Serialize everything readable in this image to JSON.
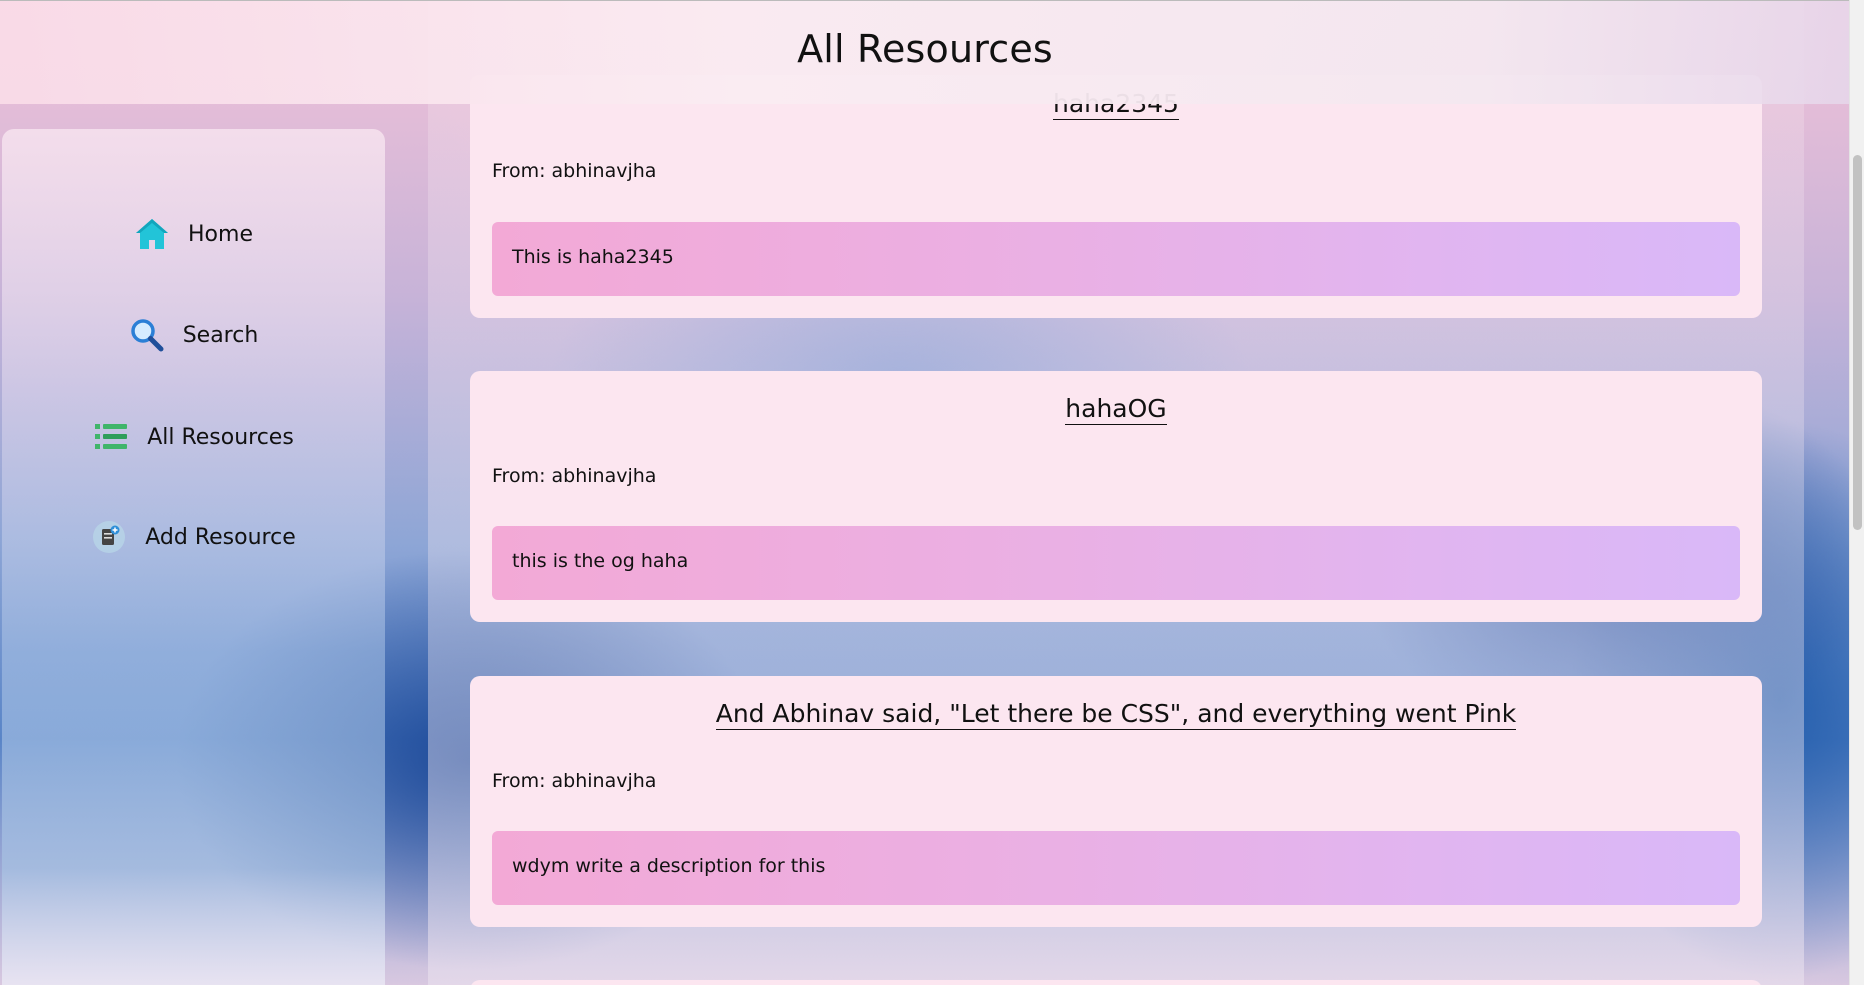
{
  "header": {
    "title": "All Resources"
  },
  "sidebar": {
    "items": [
      {
        "label": "Home",
        "icon": "home-icon"
      },
      {
        "label": "Search",
        "icon": "magnifier-icon"
      },
      {
        "label": "All Resources",
        "icon": "list-icon"
      },
      {
        "label": "Add Resource",
        "icon": "add-document-icon"
      }
    ]
  },
  "resources": [
    {
      "title": "haha2345",
      "from": "From: abhinavjha",
      "description": "This is haha2345"
    },
    {
      "title": "hahaOG",
      "from": "From: abhinavjha",
      "description": "this is the og haha"
    },
    {
      "title": "And Abhinav said, \"Let there be CSS\", and everything went Pink",
      "from": "From: abhinavjha",
      "description": "wdym write a description for this"
    }
  ],
  "colors": {
    "card_bg": "#fce6f0",
    "desc_gradient_start": "#f3a9d6",
    "desc_gradient_end": "#d9b8f8",
    "home_icon": "#22c4d8",
    "list_icon": "#3fb56a"
  }
}
